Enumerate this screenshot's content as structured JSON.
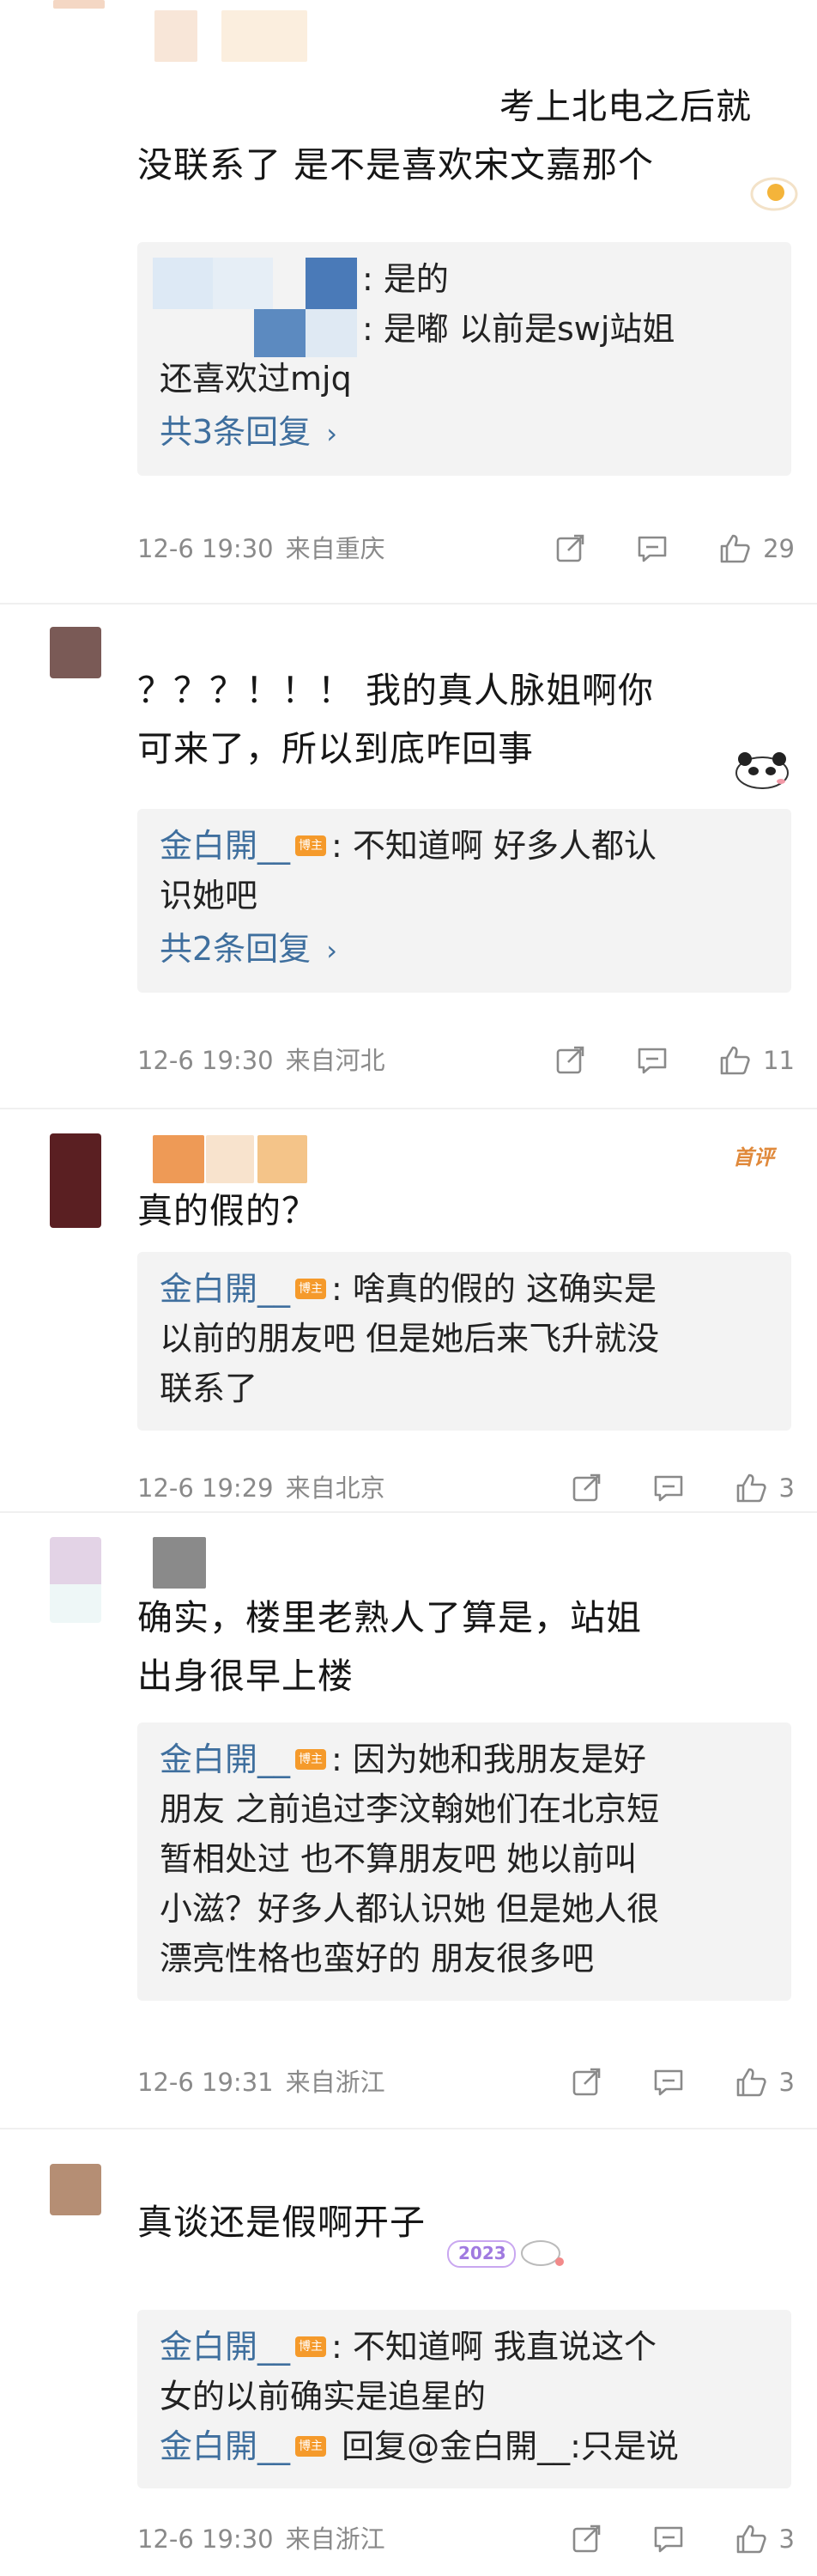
{
  "comments": [
    {
      "body_lines": [
        "考上北电之后就",
        "没联系了 是不是喜欢宋文嘉那个"
      ],
      "replies": [
        {
          "author": "",
          "badge": "",
          "text": ": 是的"
        },
        {
          "author": "",
          "badge": "",
          "text": ": 是嘟 以前是swj站姐"
        },
        {
          "author": "",
          "badge": "",
          "text": "还喜欢过mjq"
        }
      ],
      "more": "共3条回复",
      "time": "12-6 19:30",
      "location": "来自重庆",
      "likes": "29"
    },
    {
      "body_lines": [
        "？？？！！！ 我的真人脉姐啊你",
        "可来了，所以到底咋回事"
      ],
      "replies": [
        {
          "author": "金白開__",
          "badge": "博主",
          "text": ": 不知道啊 好多人都认"
        },
        {
          "author": "",
          "badge": "",
          "text": "识她吧"
        }
      ],
      "more": "共2条回复",
      "time": "12-6 19:30",
      "location": "来自河北",
      "likes": "11"
    },
    {
      "first_review": "首评",
      "body_lines": [
        "真的假的？"
      ],
      "replies": [
        {
          "author": "金白開__",
          "badge": "博主",
          "text": ": 啥真的假的 这确实是"
        },
        {
          "author": "",
          "badge": "",
          "text": "以前的朋友吧 但是她后来飞升就没"
        },
        {
          "author": "",
          "badge": "",
          "text": "联系了"
        }
      ],
      "time": "12-6 19:29",
      "location": "来自北京",
      "likes": "3"
    },
    {
      "body_lines": [
        "确实，楼里老熟人了算是，站姐",
        "出身很早上楼"
      ],
      "replies": [
        {
          "author": "金白開__",
          "badge": "博主",
          "text": ": 因为她和我朋友是好"
        },
        {
          "author": "",
          "badge": "",
          "text": "朋友 之前追过李汶翰她们在北京短"
        },
        {
          "author": "",
          "badge": "",
          "text": "暂相处过 也不算朋友吧 她以前叫"
        },
        {
          "author": "",
          "badge": "",
          "text": "小滋？好多人都认识她 但是她人很"
        },
        {
          "author": "",
          "badge": "",
          "text": "漂亮性格也蛮好的 朋友很多吧"
        }
      ],
      "time": "12-6 19:31",
      "location": "来自浙江",
      "likes": "3"
    },
    {
      "body_lines": [
        "真谈还是假啊开子"
      ],
      "sticker_text": "2023",
      "replies": [
        {
          "author": "金白開__",
          "badge": "博主",
          "text": ": 不知道啊 我直说这个"
        },
        {
          "author": "",
          "badge": "",
          "text": "女的以前确实是追星的"
        },
        {
          "author": "金白開__",
          "badge": "博主",
          "text": " 回复@金白開__:只是说"
        }
      ],
      "time": "12-6 19:30",
      "location": "来自浙江",
      "likes": "3"
    }
  ],
  "colors": {
    "author": "#3f6f9e",
    "meta": "#8a8a8a",
    "reply_bg": "#f3f3f3",
    "badge": "#f59a2b"
  },
  "icons": [
    "share-icon",
    "comment-icon",
    "like-icon"
  ]
}
